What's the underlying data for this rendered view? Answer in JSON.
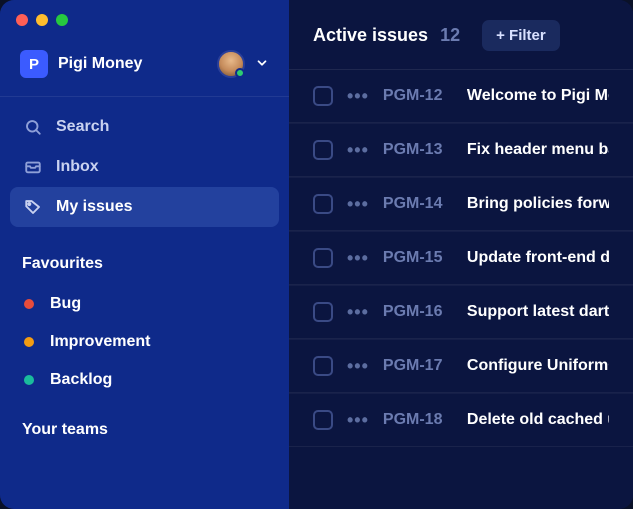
{
  "window": {
    "traffic": [
      "red",
      "yellow",
      "green"
    ]
  },
  "workspace": {
    "badge": "P",
    "name": "Pigi Money"
  },
  "nav": {
    "search": "Search",
    "inbox": "Inbox",
    "my_issues": "My issues"
  },
  "favourites": {
    "title": "Favourites",
    "items": [
      {
        "label": "Bug",
        "color": "#e74c3c"
      },
      {
        "label": "Improvement",
        "color": "#f39c12"
      },
      {
        "label": "Backlog",
        "color": "#1abc9c"
      }
    ]
  },
  "teams": {
    "title": "Your teams"
  },
  "header": {
    "title": "Active issues",
    "count": "12",
    "filter_label": "+ Filter"
  },
  "issues": [
    {
      "id": "PGM-12",
      "title": "Welcome to Pigi Money"
    },
    {
      "id": "PGM-13",
      "title": "Fix header menu bar alignment"
    },
    {
      "id": "PGM-14",
      "title": "Bring policies forward"
    },
    {
      "id": "PGM-15",
      "title": "Update front-end dependencies"
    },
    {
      "id": "PGM-16",
      "title": "Support latest dart sass release"
    },
    {
      "id": "PGM-17",
      "title": "Configure UniformCSS variables"
    },
    {
      "id": "PGM-18",
      "title": "Delete old cached users"
    }
  ]
}
